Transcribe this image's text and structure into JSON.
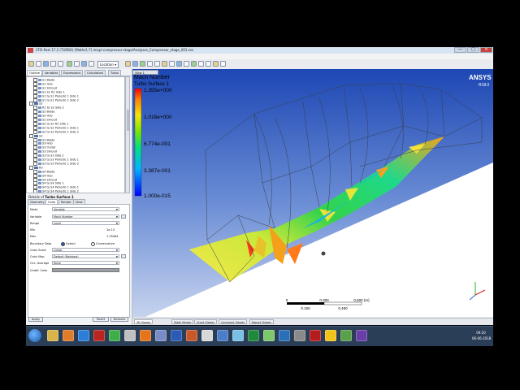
{
  "window": {
    "title": "CFD-Post 17.2 (TURBO) [Mathsf, F] mixpl-compressor-stage/Analyses_Compressor_stage_001.res",
    "controls": [
      "—",
      "□",
      "×"
    ]
  },
  "menu": [
    "File",
    "Edit",
    "Monitor",
    "Session",
    "Insert",
    "Tools",
    "Help"
  ],
  "toolbar": {
    "location_label": "Location ▾"
  },
  "left_panel": {
    "tabs": [
      "Outline",
      "Variables",
      "Expressions",
      "Calculators",
      "Turbo"
    ],
    "tree": [
      {
        "label": "S1 Blade",
        "folder": false,
        "checked": true
      },
      {
        "label": "S1 Hub",
        "folder": false,
        "checked": true
      },
      {
        "label": "S1 Shroud",
        "folder": false,
        "checked": true
      },
      {
        "label": "S1 S1 R1 Side 1",
        "folder": false,
        "checked": true
      },
      {
        "label": "S1 to S1 Periodic 1 Side 1",
        "folder": false,
        "checked": true
      },
      {
        "label": "S1 to S1 Periodic 1 Side 2",
        "folder": false,
        "checked": true
      },
      {
        "label": "S2",
        "folder": true,
        "checked": true
      },
      {
        "label": "R1 to S2 Side 2",
        "folder": false,
        "checked": true
      },
      {
        "label": "S2 Blade",
        "folder": false,
        "checked": true
      },
      {
        "label": "S2 Hub",
        "folder": false,
        "checked": true
      },
      {
        "label": "S2 Shroud",
        "folder": false,
        "checked": true
      },
      {
        "label": "S2 to S2 R2 Side 1",
        "folder": false,
        "checked": true
      },
      {
        "label": "S2 to S2 Periodic 1 Side 1",
        "folder": false,
        "checked": true
      },
      {
        "label": "S2 to S2 Periodic 1 Side 2",
        "folder": false,
        "checked": true
      },
      {
        "label": "S3",
        "folder": true,
        "checked": true
      },
      {
        "label": "S3 Blade",
        "folder": false,
        "checked": true
      },
      {
        "label": "S3 Hub",
        "folder": false,
        "checked": true
      },
      {
        "label": "S3 Outlet",
        "folder": false,
        "checked": true
      },
      {
        "label": "S3 Shroud",
        "folder": false,
        "checked": true
      },
      {
        "label": "S3 to S3 Side 2",
        "folder": false,
        "checked": true
      },
      {
        "label": "S3 to S3 Periodic 1 Side 1",
        "folder": false,
        "checked": true
      },
      {
        "label": "S3 to S3 Periodic 1 Side 2",
        "folder": false,
        "checked": true
      },
      {
        "label": "R3",
        "folder": true,
        "checked": true
      },
      {
        "label": "S4 Blade",
        "folder": false,
        "checked": true
      },
      {
        "label": "S4 Hub",
        "folder": false,
        "checked": true
      },
      {
        "label": "S4 Shroud",
        "folder": false,
        "checked": true
      },
      {
        "label": "S4 to S4 Side 1",
        "folder": false,
        "checked": true
      },
      {
        "label": "S4 to S4 Periodic 1 Side 1",
        "folder": false,
        "checked": true
      },
      {
        "label": "S4 to S4 Periodic 1 Side 2",
        "folder": false,
        "checked": true
      }
    ],
    "details_title_prefix": "Details of ",
    "details_title_obj": "Turbo Surface 1",
    "detail_tabs": [
      "Geometry",
      "Color",
      "Render",
      "View"
    ],
    "fields": {
      "mode_label": "Mode",
      "mode_value": "Variable",
      "variable_label": "Variable",
      "variable_value": "Mach Number",
      "range_label": "Range",
      "range_value": "Local",
      "min_label": "Min",
      "min_value": "1e-15",
      "max_label": "Max",
      "max_value": "1.35484",
      "boundary_label": "Boundary Data",
      "hybrid_label": "Hybrid",
      "conservative_label": "Conservative",
      "colorscale_label": "Color Scale",
      "colorscale_value": "Linear",
      "colormap_label": "Color Map",
      "colormap_value": "Default (Rainbow)",
      "circ_label": "Circ. Average",
      "circ_value": "None",
      "undef_label": "Undef. Color"
    },
    "buttons": {
      "apply": "Apply",
      "reset": "Reset",
      "defaults": "Defaults"
    }
  },
  "viewport": {
    "view_tab": "View 1",
    "legend_title": "Mach Number",
    "legend_subtitle": "Turbo Surface 1",
    "legend_ticks": [
      "1.355e+000",
      "1.016e+000",
      "6.774e-001",
      "3.387e-001",
      "1.000e-015"
    ],
    "brand": "ANSYS",
    "version": "R18.0",
    "scale_labels": [
      "0",
      "0.300",
      "0.600 (m)"
    ],
    "scale_sublabels": [
      "0.150",
      "0.450"
    ],
    "colors": {
      "bg_top": "#1d47b4",
      "bg_bottom": "#c6d3ee",
      "cut_plane": "#ffffff"
    }
  },
  "bottom_tabs": [
    "3D Viewer",
    "Table Viewer",
    "Chart Viewer",
    "Comment Viewer",
    "Report Viewer"
  ],
  "taskbar": {
    "apps": [
      "windows-explorer",
      "media-player",
      "ie",
      "filezilla",
      "chrome",
      "app",
      "firefox",
      "app2",
      "word",
      "paint",
      "ansys-workbench",
      "app3",
      "notepad",
      "excel",
      "app4",
      "app5",
      "app6",
      "acrobat",
      "cfd-post",
      "app7",
      "app8"
    ],
    "time": "09:20",
    "date": "06-06-2018"
  }
}
